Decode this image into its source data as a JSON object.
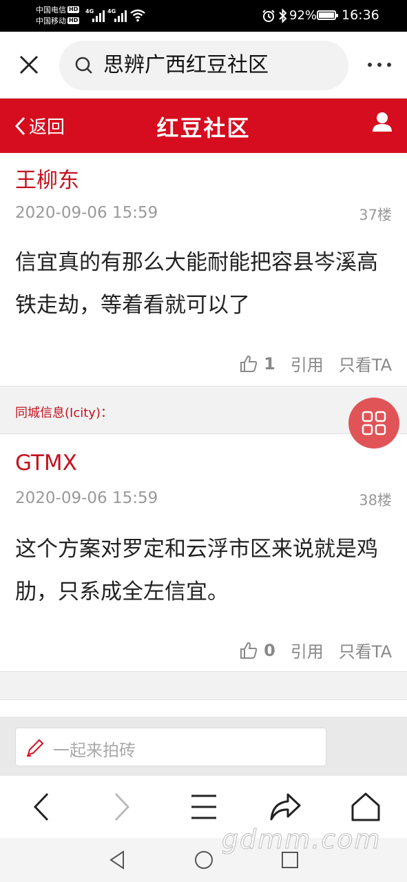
{
  "status_bar": {
    "carrier1": "中国电信",
    "carrier2": "中国移动",
    "hd": "HD",
    "net1": "4G",
    "net2": "4G",
    "battery": "92%",
    "time": "16:36"
  },
  "browser": {
    "search_text": "思辨广西红豆社区"
  },
  "header": {
    "back_label": "返回",
    "site_title": "红豆社区"
  },
  "posts": [
    {
      "author": "王柳东",
      "time": "2020-09-06 15:59",
      "floor": "37楼",
      "content": "信宜真的有那么大能耐能把容县岑溪高铁走劫，等着看就可以了",
      "likes": "1",
      "quote_label": "引用",
      "only_ta_label": "只看TA"
    },
    {
      "author": "GTMX",
      "time": "2020-09-06 15:59",
      "floor": "38楼",
      "content": "这个方案对罗定和云浮市区来说就是鸡肋，只系成全左信宜。",
      "likes": "0",
      "quote_label": "引用",
      "only_ta_label": "只看TA"
    }
  ],
  "ad_label": "同城信息(Icity)：",
  "comment": {
    "placeholder": "一起来拍砖"
  },
  "watermark": "gdmm.com",
  "colors": {
    "brand_red": "#d60d1e",
    "author_red": "#c4101e",
    "float_button": "#e05457"
  },
  "icons": {
    "close": "close-icon",
    "search": "search-icon",
    "more": "more-dots-icon",
    "back": "chevron-left-icon",
    "user": "user-icon",
    "like": "thumbs-up-icon",
    "grid": "grid-icon",
    "pen": "pen-icon",
    "nav_back": "arrow-left-icon",
    "nav_forward": "arrow-right-icon",
    "menu": "menu-icon",
    "share": "share-icon",
    "home": "home-icon"
  }
}
